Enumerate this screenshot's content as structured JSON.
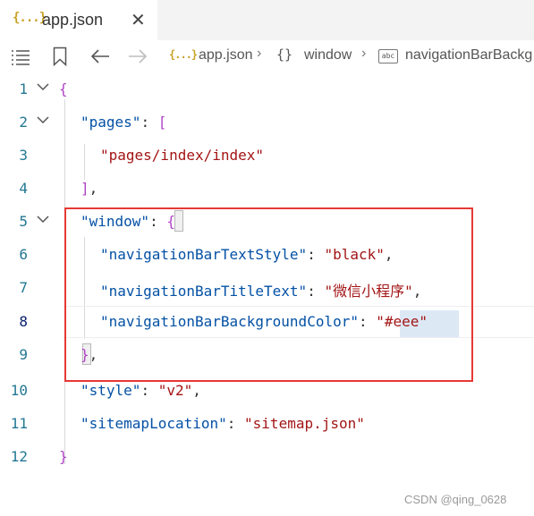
{
  "tab": {
    "icon": "{...}",
    "title": "app.json",
    "close_icon": "close-icon"
  },
  "toolbar": {
    "list_icon": "list-icon",
    "bookmark_icon": "bookmark-icon",
    "back_icon": "arrow-left-icon",
    "forward_icon": "arrow-right-icon"
  },
  "breadcrumb": {
    "file_icon": "{...}",
    "file": "app.json",
    "obj_icon": "{}",
    "window": "window",
    "prop_icon": "abc",
    "property": "navigationBarBackg"
  },
  "editor": {
    "lines": [
      {
        "num": "1",
        "code": "{"
      },
      {
        "num": "2",
        "key": "\"pages\"",
        "colon": ": ",
        "open": "["
      },
      {
        "num": "3",
        "value": "\"pages/index/index\""
      },
      {
        "num": "4",
        "close": "]",
        "comma": ","
      },
      {
        "num": "5",
        "key": "\"window\"",
        "colon": ": ",
        "open": "{"
      },
      {
        "num": "6",
        "key": "\"navigationBarTextStyle\"",
        "colon": ": ",
        "value": "\"black\"",
        "comma": ","
      },
      {
        "num": "7",
        "key": "\"navigationBarTitleText\"",
        "colon": ": ",
        "value": "\"微信小程序\"",
        "comma": ","
      },
      {
        "num": "8",
        "key": "\"navigationBarBackgroundColor\"",
        "colon": ": ",
        "value_pre": "\"",
        "value_sel": "#eee",
        "value_post": "\""
      },
      {
        "num": "9",
        "close": "}",
        "comma": ","
      },
      {
        "num": "10",
        "key": "\"style\"",
        "colon": ": ",
        "value": "\"v2\"",
        "comma": ","
      },
      {
        "num": "11",
        "key": "\"sitemapLocation\"",
        "colon": ": ",
        "value": "\"sitemap.json\""
      },
      {
        "num": "12",
        "code": "}"
      }
    ]
  },
  "watermark": "CSDN @qing_0628",
  "colors": {
    "key": "#0451a5",
    "string": "#a31515",
    "bracket": "#b044c7",
    "line_number": "#237893",
    "highlight_box": "#e53935"
  }
}
